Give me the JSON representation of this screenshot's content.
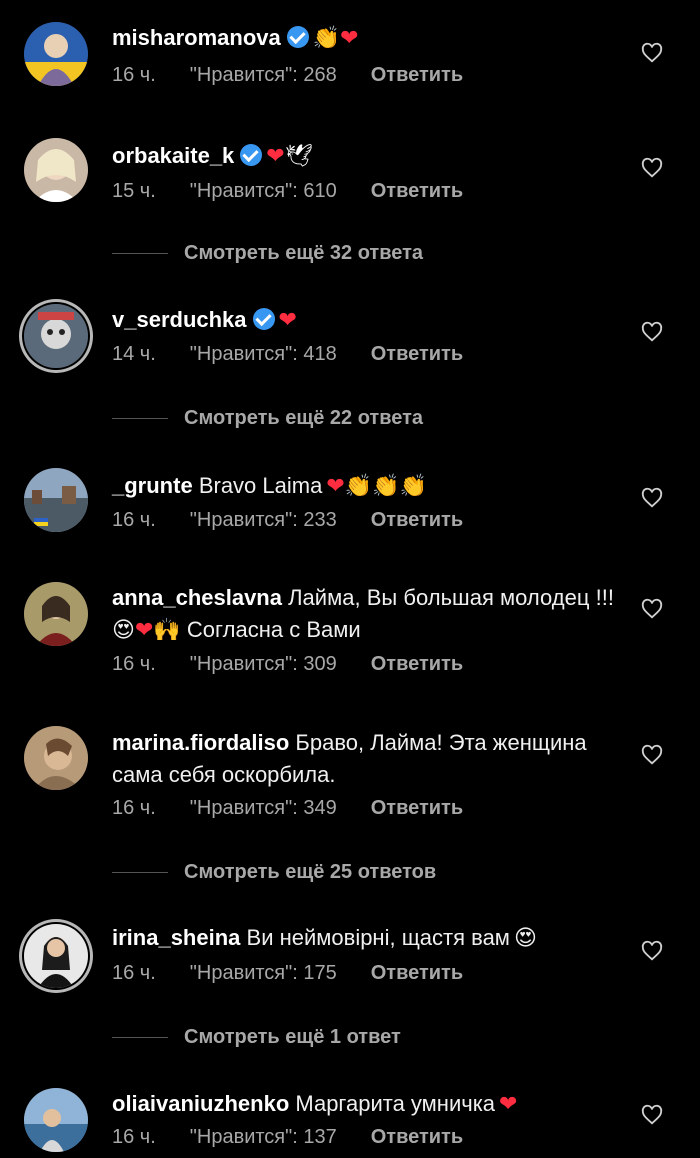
{
  "comments": [
    {
      "username": "misharomanova",
      "verified": true,
      "text": "",
      "emoji": "👏❤",
      "time": "16 ч.",
      "likes": "\"Нравится\": 268",
      "reply": "Ответить"
    },
    {
      "username": "orbakaite_k",
      "verified": true,
      "text": "",
      "emoji": "❤🕊",
      "time": "15 ч.",
      "likes": "\"Нравится\": 610",
      "reply": "Ответить"
    },
    {
      "username": "v_serduchka",
      "verified": true,
      "text": "",
      "emoji": "❤",
      "time": "14 ч.",
      "likes": "\"Нравится\": 418",
      "reply": "Ответить"
    },
    {
      "username": "_grunte",
      "verified": false,
      "text": "Bravo Laima",
      "emoji": "❤👏👏👏",
      "time": "16 ч.",
      "likes": "\"Нравится\": 233",
      "reply": "Ответить"
    },
    {
      "username": "anna_cheslavna",
      "verified": false,
      "text": "Лайма, Вы большая молодец !!! 😍❤🙌 Согласна с Вами",
      "emoji": "",
      "time": "16 ч.",
      "likes": "\"Нравится\": 309",
      "reply": "Ответить"
    },
    {
      "username": "marina.fiordaliso",
      "verified": false,
      "text": "Браво, Лайма! Эта женщина сама себя оскорбила.",
      "emoji": "",
      "time": "16 ч.",
      "likes": "\"Нравится\": 349",
      "reply": "Ответить"
    },
    {
      "username": "irina_sheina",
      "verified": false,
      "text": "Ви неймовірні, щастя вам",
      "emoji": "😍",
      "time": "16 ч.",
      "likes": "\"Нравится\": 175",
      "reply": "Ответить"
    },
    {
      "username": "oliaivaniuzhenko",
      "verified": false,
      "text": "Маргарита умничка",
      "emoji": "❤",
      "time": "16 ч.",
      "likes": "\"Нравится\": 137",
      "reply": "Ответить"
    }
  ],
  "view_more": [
    "Смотреть ещё 32 ответа",
    "Смотреть ещё 22 ответа",
    "Смотреть ещё 25 ответов",
    "Смотреть ещё 1 ответ"
  ],
  "icons": {
    "like": "heart-outline-icon",
    "verified": "verified-badge-icon"
  },
  "colors": {
    "background": "#000000",
    "verified": "#3897f0",
    "heart": "#ff2d3f",
    "meta": "#a8a8a8"
  }
}
